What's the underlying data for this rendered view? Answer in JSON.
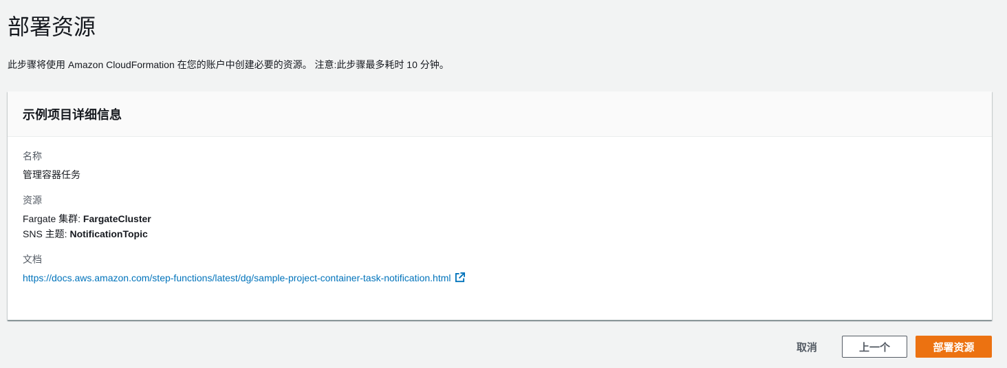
{
  "page": {
    "title": "部署资源",
    "description": "此步骤将使用 Amazon CloudFormation 在您的账户中创建必要的资源。 注意:此步骤最多耗时 10 分钟。"
  },
  "panel": {
    "title": "示例项目详细信息",
    "name_label": "名称",
    "name_value": "管理容器任务",
    "resources_label": "资源",
    "resources": [
      {
        "prefix": "Fargate 集群: ",
        "value": "FargateCluster"
      },
      {
        "prefix": "SNS 主题: ",
        "value": "NotificationTopic"
      }
    ],
    "docs_label": "文档",
    "docs_link": "https://docs.aws.amazon.com/step-functions/latest/dg/sample-project-container-task-notification.html",
    "docs_icon": "external-link-icon"
  },
  "actions": {
    "cancel": "取消",
    "previous": "上一个",
    "deploy": "部署资源",
    "accent": "#ec7211"
  }
}
